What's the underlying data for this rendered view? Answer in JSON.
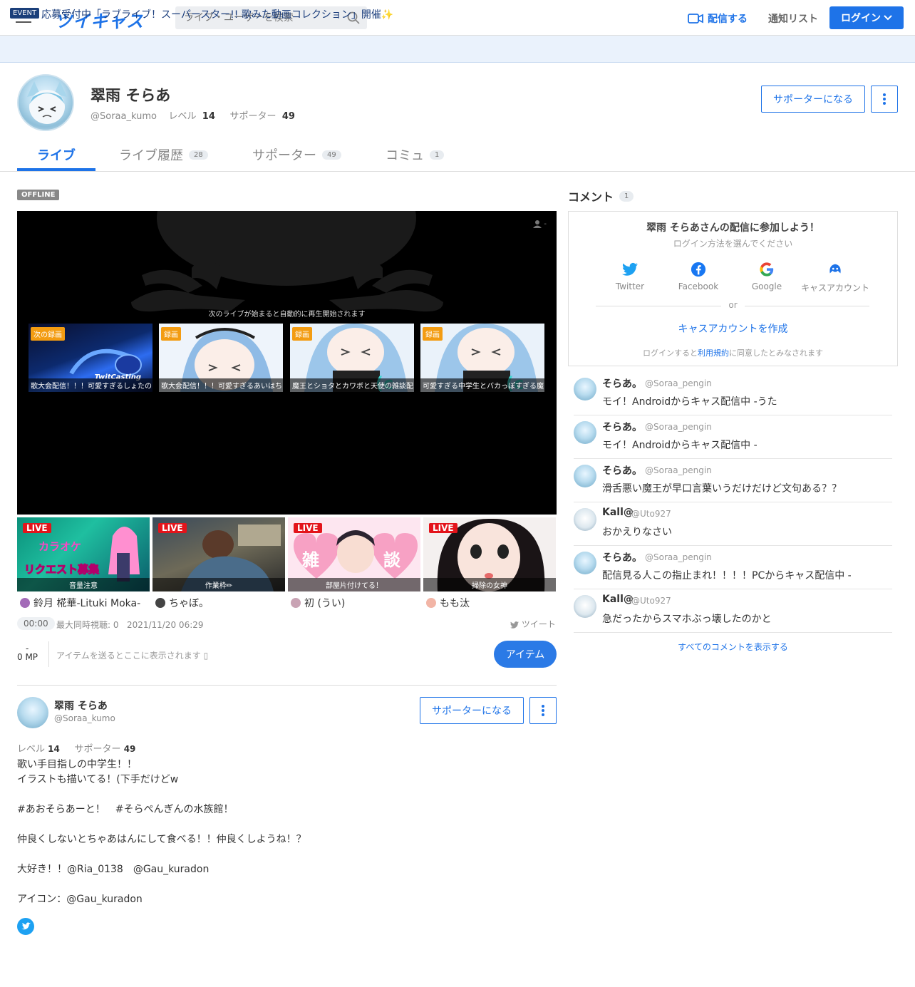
{
  "header": {
    "logo": "ツイキャス",
    "search_placeholder": "ライブ・ユーザーを検索",
    "broadcast_label": "配信する",
    "notify_label": "通知リスト",
    "login_label": "ログイン"
  },
  "event_bar": {
    "badge": "EVENT",
    "text": "応募受付中「ラブライブ！スーパースター!! 歌みた動画コレクション」開催✨"
  },
  "profile": {
    "name": "翠雨 そらあ",
    "handle": "@Soraa_kumo",
    "level_label": "レベル",
    "level": "14",
    "supporter_label": "サポーター",
    "supporters": "49",
    "support_button": "サポーターになる"
  },
  "tabs": [
    {
      "label": "ライブ",
      "count": ""
    },
    {
      "label": "ライブ履歴",
      "count": "28"
    },
    {
      "label": "サポーター",
      "count": "49"
    },
    {
      "label": "コミュ",
      "count": "1"
    }
  ],
  "player": {
    "status": "OFFLINE",
    "next_message": "次のライブが始まると自動的に再生開始されます",
    "viewers": "-",
    "thumbs": [
      {
        "badge": "次の録画",
        "caption": "歌大会配信！！！可愛すぎるしょたの",
        "watermark": "TwitCasting"
      },
      {
        "badge": "録画",
        "caption": "歌大会配信！！！可愛すぎるあいはち"
      },
      {
        "badge": "録画",
        "caption": "魔王とショタとカワボと天使の雑談配"
      },
      {
        "badge": "録画",
        "caption": "可愛すぎる中学生とバカっぽすぎる魔"
      }
    ]
  },
  "live_grid": [
    {
      "badge": "LIVE",
      "caption": "音量注意",
      "user": "鈴月 椛華-Lituki Moka-",
      "art": [
        "カラオケ",
        "リクエスト募集"
      ]
    },
    {
      "badge": "LIVE",
      "caption": "作業枠✏",
      "user": "ちゃぼ。"
    },
    {
      "badge": "LIVE",
      "caption": "部屋片付けてる！",
      "user": "初 (うい)",
      "art": [
        "雑",
        "談"
      ]
    },
    {
      "badge": "LIVE",
      "caption": "掃除の女神",
      "user": "もも汰"
    }
  ],
  "stats": {
    "time": "00:00",
    "max_viewers": "最大同時視聴: 0",
    "date": "2021/11/20 06:29",
    "tweet": "ツイート",
    "mp_dash": "-",
    "mp": "0 MP",
    "item_hint": "アイテムを送るとここに表示されます",
    "item_button": "アイテム"
  },
  "profile_card": {
    "name": "翠雨 そらあ",
    "handle": "@Soraa_kumo",
    "support_button": "サポーターになる",
    "level_label": "レベル",
    "level": "14",
    "supporter_label": "サポーター",
    "supporters": "49",
    "bio": [
      "歌い手目指しの中学生！！",
      "イラストも描いてる！(下手だけどw",
      "",
      "#あおそらあーと！　#そらぺんぎんの水族館！",
      "",
      "仲良くしないとちゃあはんにして食べる！！仲良くしようね！？",
      "",
      "大好き！！@Ria_0138　@Gau_kuradon",
      "",
      "アイコン：@Gau_kuradon"
    ]
  },
  "comments_panel": {
    "title": "コメント",
    "count": "1",
    "join_title": "翠雨 そらあさんの配信に参加しよう！",
    "join_sub": "ログイン方法を選んでください",
    "providers": [
      "Twitter",
      "Facebook",
      "Google",
      "キャスアカウント"
    ],
    "or": "or",
    "create_account": "キャスアカウントを作成",
    "terms_prefix": "ログインすると",
    "terms_link": "利用規約",
    "terms_suffix": "に同意したとみなされます",
    "comments": [
      {
        "name": "そらあ。",
        "handle": "@Soraa_pengin",
        "text": "モイ！Androidからキャス配信中 -うた"
      },
      {
        "name": "そらあ。",
        "handle": "@Soraa_pengin",
        "text": "モイ！Androidからキャス配信中 -"
      },
      {
        "name": "そらあ。",
        "handle": "@Soraa_pengin",
        "text": "滑舌悪い魔王が早口言葉いうだけだけど文句ある？？"
      },
      {
        "name": "Kall@",
        "handle": "@Uto927",
        "text": "おかえりなさい"
      },
      {
        "name": "そらあ。",
        "handle": "@Soraa_pengin",
        "text": "配信見る人この指止まれ！！！！PCからキャス配信中 -"
      },
      {
        "name": "Kall@",
        "handle": "@Uto927",
        "text": "急だったからスマホぶっ壊したのかと"
      }
    ],
    "show_all": "すべてのコメントを表示する"
  }
}
